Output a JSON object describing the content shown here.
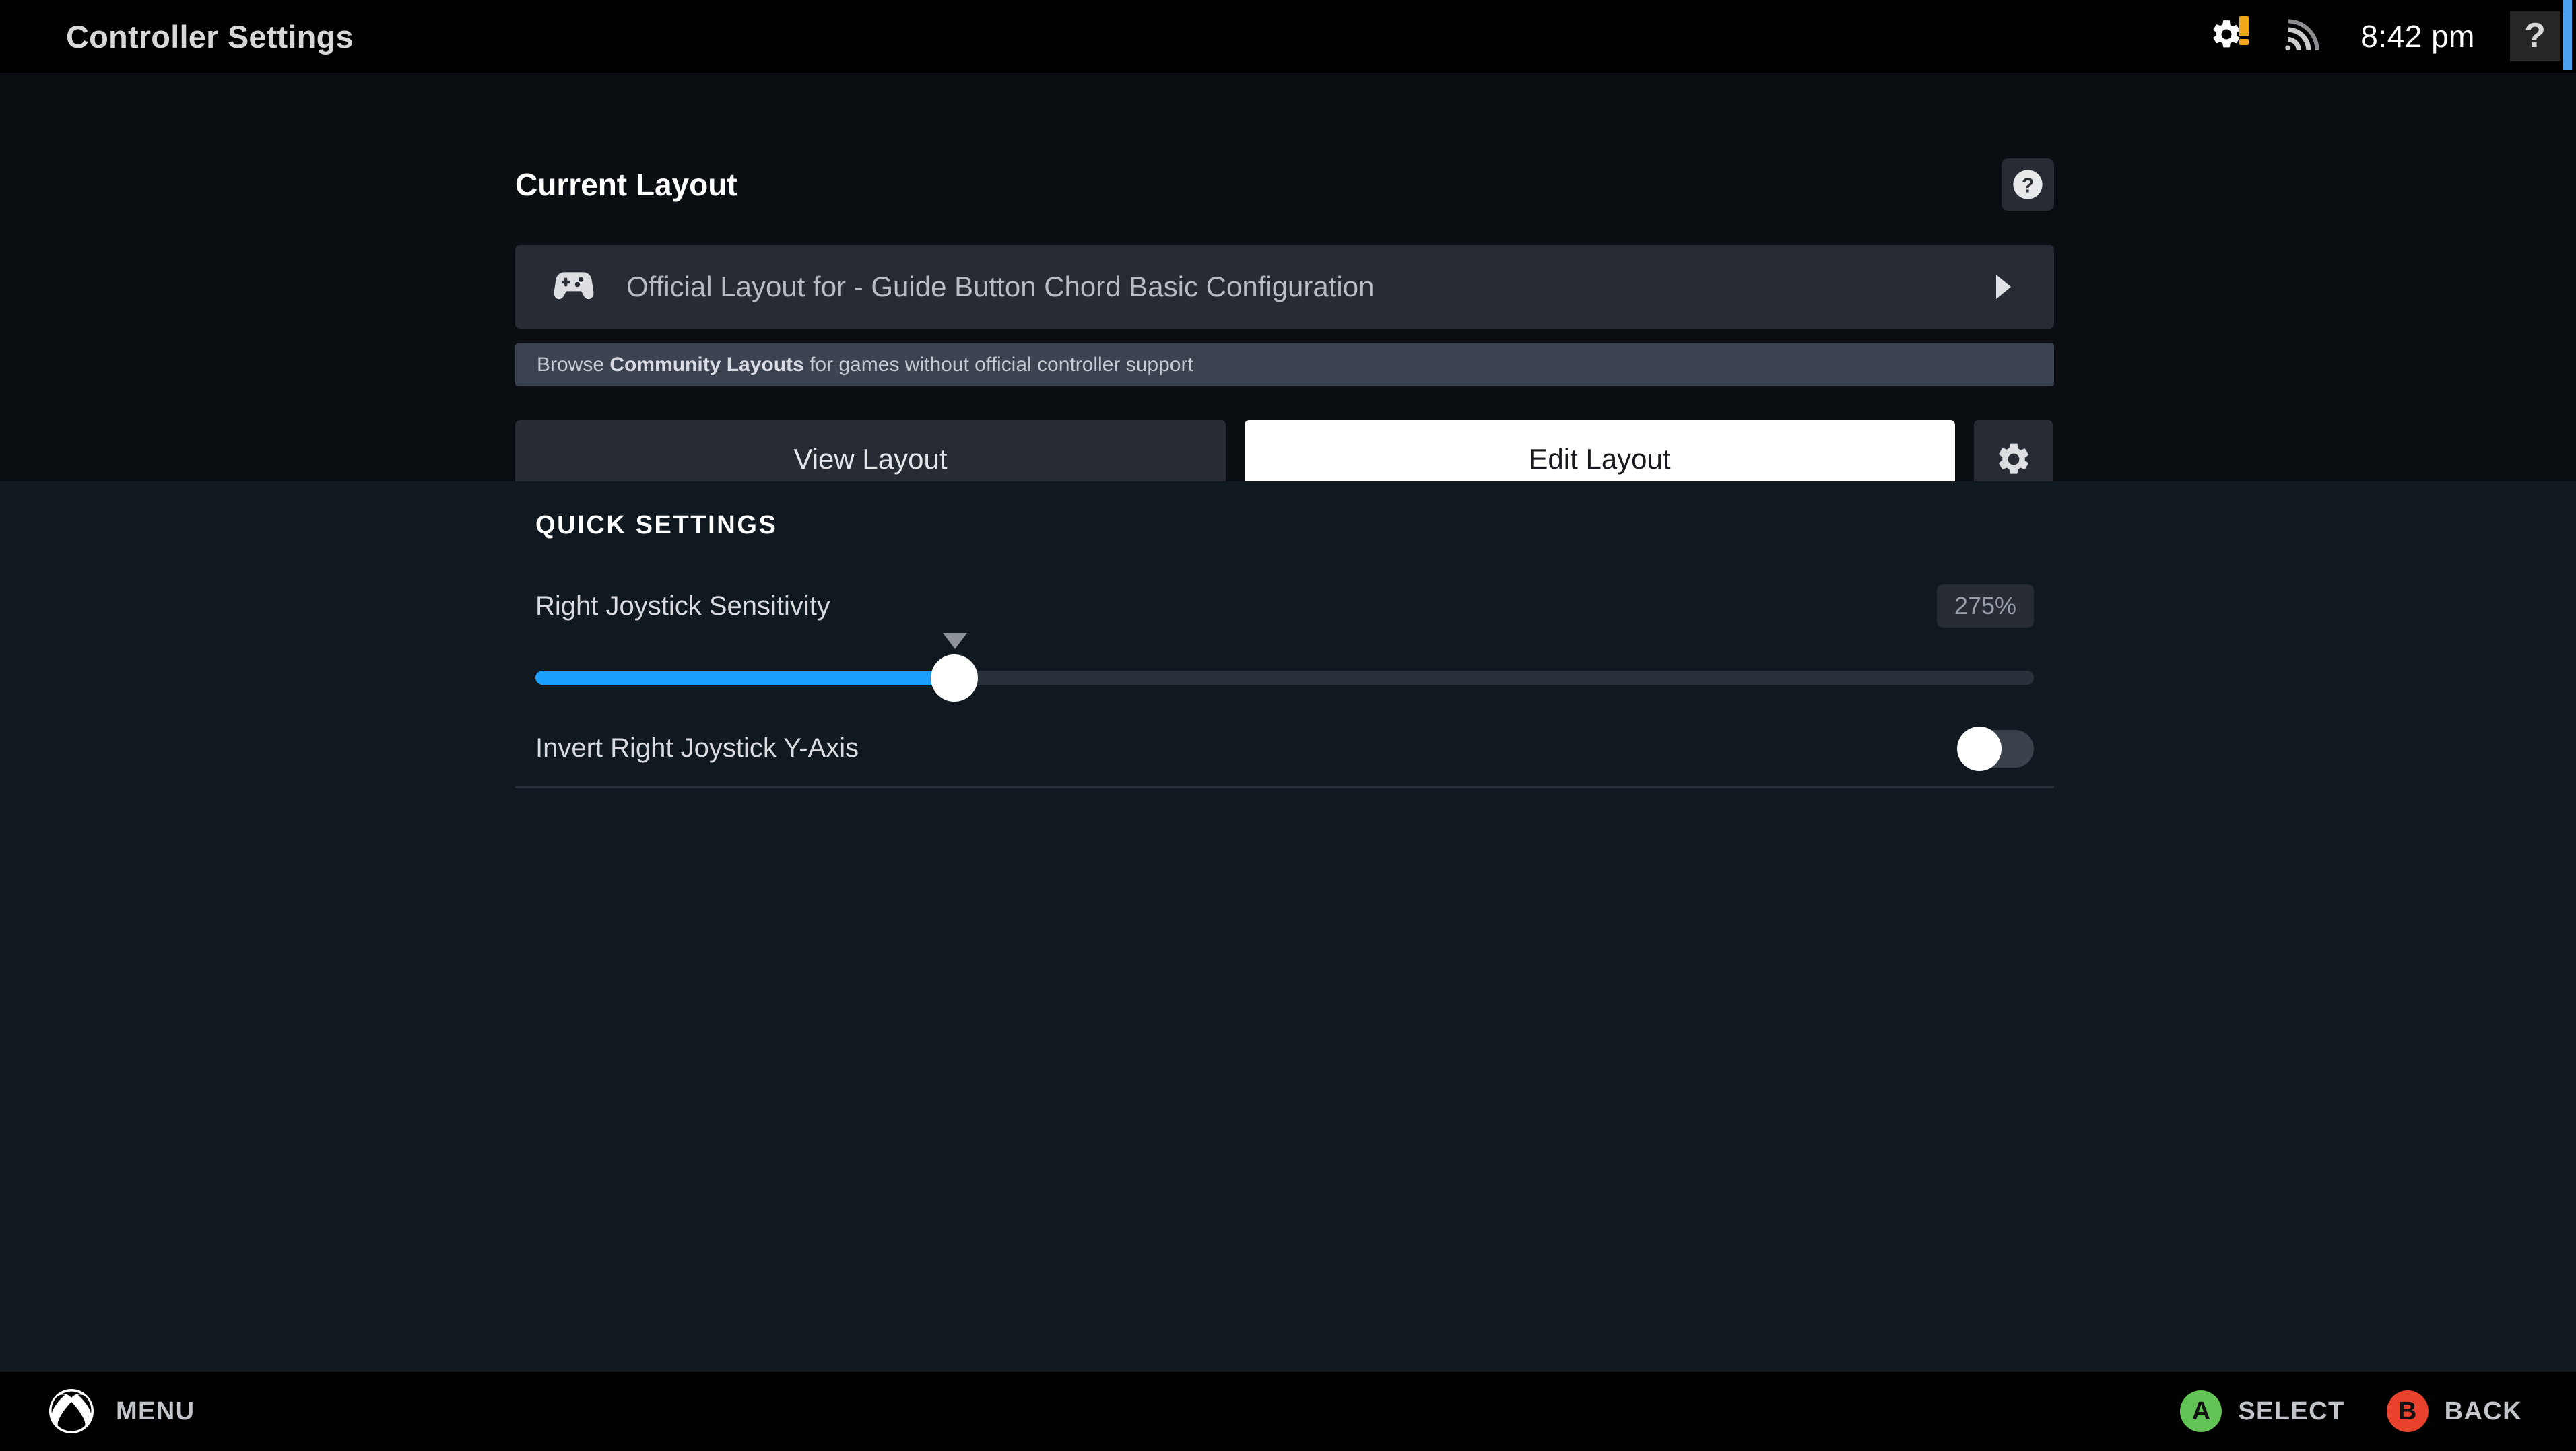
{
  "header": {
    "title": "Controller Settings",
    "clock": "8:42 pm",
    "gear_icon": "gear-icon",
    "gear_badge": "alert-badge",
    "wifi_icon": "wifi-icon",
    "help_label": "?"
  },
  "current_layout": {
    "section_title": "Current Layout",
    "help_icon": "question-circle-icon",
    "gamepad_icon": "gamepad-icon",
    "layout_name": "Official Layout for - Guide Button Chord Basic Configuration",
    "chevron_icon": "chevron-right-icon",
    "community_prefix": "Browse ",
    "community_bold": "Community Layouts",
    "community_suffix": " for games without official controller support",
    "view_button": "View Layout",
    "edit_button": "Edit Layout",
    "settings_icon": "gear-icon"
  },
  "quick_settings": {
    "title": "QUICK SETTINGS",
    "sensitivity": {
      "label": "Right Joystick Sensitivity",
      "value": "275%",
      "fill_percent": 27.6
    },
    "invert": {
      "label": "Invert Right Joystick Y-Axis",
      "state": "off"
    }
  },
  "footer": {
    "menu_icon": "xbox-logo-icon",
    "menu_label": "MENU",
    "select_glyph": "A",
    "select_label": "SELECT",
    "back_glyph": "B",
    "back_label": "BACK"
  },
  "colors": {
    "accent_blue": "#1a9fff",
    "focus_blue": "#4ba3f0",
    "badge_orange": "#f0a818",
    "a_green": "#61c454",
    "b_red": "#e8422c"
  }
}
